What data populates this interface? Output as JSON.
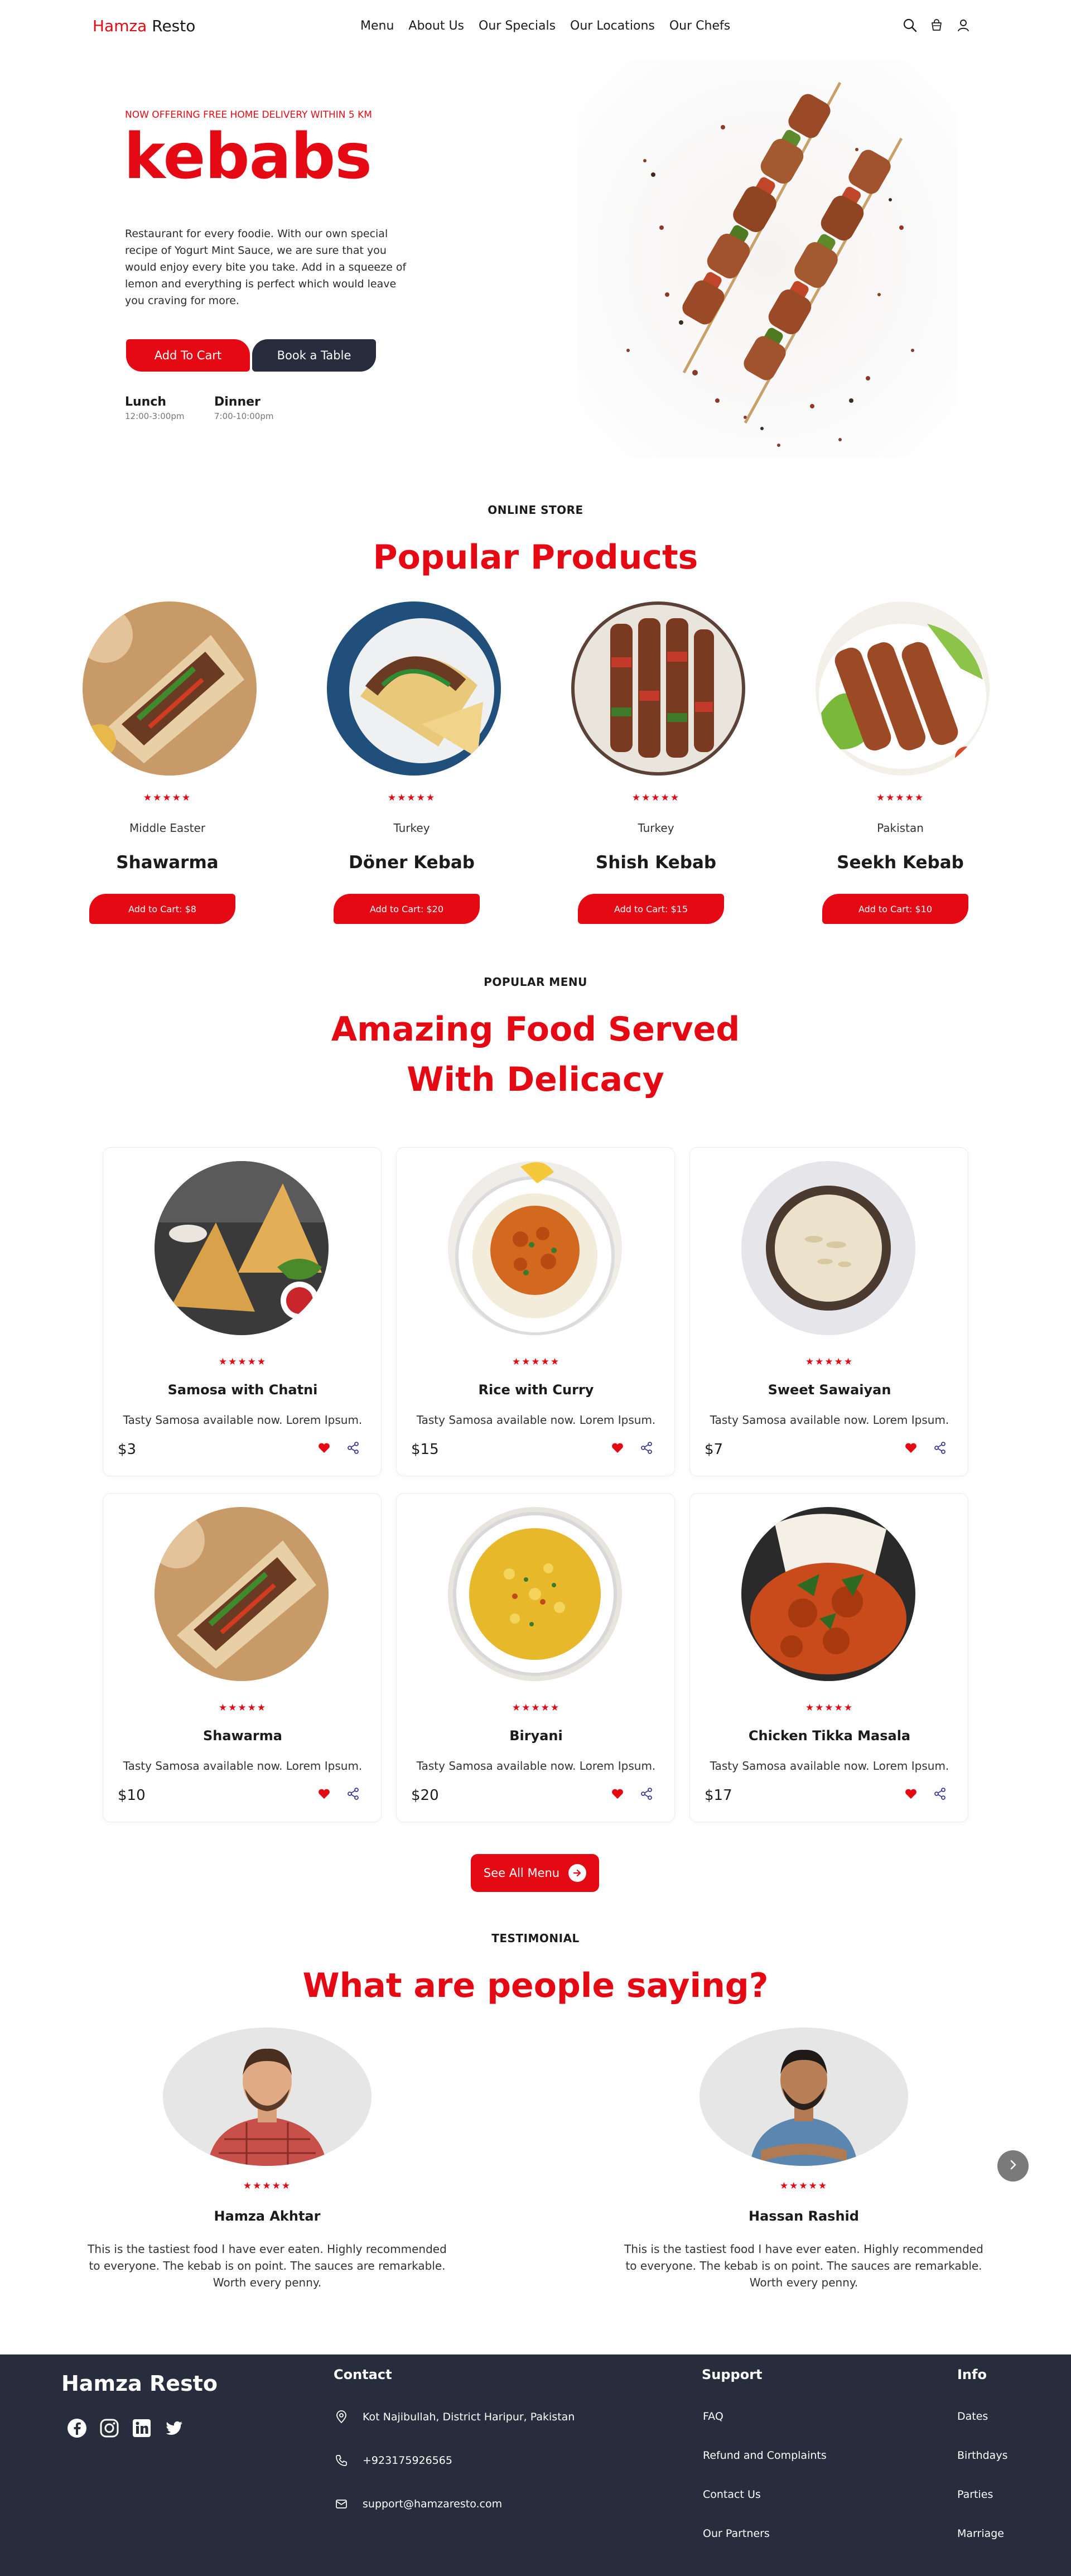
{
  "header": {
    "logo_part1": "Hamza",
    "logo_part2": " Resto",
    "nav": [
      "Menu",
      "About Us",
      "Our Specials",
      "Our Locations",
      "Our Chefs"
    ],
    "icons": [
      "search-icon",
      "cart-icon",
      "user-icon"
    ]
  },
  "hero": {
    "note": "NOW OFFERING FREE HOME DELIVERY WITHIN 5 KM",
    "title": "kebabs",
    "description": "Restaurant for every foodie. With our own special recipe of Yogurt Mint Sauce, we are sure that you would enjoy every bite you take. Add in a squeeze of lemon and everything is perfect which would leave you craving for more.",
    "add_to_cart": "Add To Cart",
    "book_table": "Book a Table",
    "lunch_label": "Lunch",
    "lunch_time": "12:00-3:00pm",
    "dinner_label": "Dinner",
    "dinner_time": "7:00-10:00pm"
  },
  "store": {
    "eyebrow": "ONLINE STORE",
    "heading": "Popular Products",
    "products": [
      {
        "origin": "Middle Easter",
        "name": "Shawarma",
        "cart": "Add to Cart: $8",
        "rating": 5
      },
      {
        "origin": "Turkey",
        "name": "Döner Kebab",
        "cart": "Add to Cart: $20",
        "rating": 5
      },
      {
        "origin": "Turkey",
        "name": "Shish Kebab",
        "cart": "Add to Cart: $15",
        "rating": 5
      },
      {
        "origin": "Pakistan",
        "name": "Seekh Kebab",
        "cart": "Add to Cart: $10",
        "rating": 5
      }
    ]
  },
  "menu": {
    "eyebrow": "POPULAR MENU",
    "heading_line1": "Amazing Food Served",
    "heading_line2": "With Delicacy",
    "items": [
      {
        "name": "Samosa with Chatni",
        "desc": "Tasty Samosa available now. Lorem Ipsum.",
        "price": "$3",
        "rating": 5
      },
      {
        "name": "Rice with Curry",
        "desc": "Tasty Samosa available now. Lorem Ipsum.",
        "price": "$15",
        "rating": 5
      },
      {
        "name": "Sweet Sawaiyan",
        "desc": "Tasty Samosa available now. Lorem Ipsum.",
        "price": "$7",
        "rating": 5
      },
      {
        "name": "Shawarma",
        "desc": "Tasty Samosa available now. Lorem Ipsum.",
        "price": "$10",
        "rating": 5
      },
      {
        "name": "Biryani",
        "desc": "Tasty Samosa available now. Lorem Ipsum.",
        "price": "$20",
        "rating": 5
      },
      {
        "name": "Chicken Tikka Masala",
        "desc": "Tasty Samosa available now. Lorem Ipsum.",
        "price": "$17",
        "rating": 5
      }
    ],
    "see_all": "See All Menu"
  },
  "testimonials": {
    "eyebrow": "TESTIMONIAL",
    "heading": "What are people saying?",
    "items": [
      {
        "name": "Hamza Akhtar",
        "quote": "This is the tastiest food I have ever eaten. Highly recommended to everyone. The kebab is on point. The sauces are remarkable. Worth every penny.",
        "rating": 5
      },
      {
        "name": "Hassan Rashid",
        "quote": "This is the tastiest food I have ever eaten. Highly recommended to everyone. The kebab is on point. The sauces are remarkable. Worth every penny.",
        "rating": 5
      }
    ]
  },
  "footer": {
    "brand": "Hamza Resto",
    "social": [
      "facebook-icon",
      "instagram-icon",
      "linkedin-icon",
      "twitter-icon"
    ],
    "contact_heading": "Contact",
    "address": "Kot Najibullah, District Haripur, Pakistan",
    "phone": "+923175926565",
    "email": "support@hamzaresto.com",
    "support_heading": "Support",
    "support_links": [
      "FAQ",
      "Refund and Complaints",
      "Contact Us",
      "Our Partners"
    ],
    "info_heading": "Info",
    "info_links": [
      "Dates",
      "Birthdays",
      "Parties",
      "Marriage"
    ]
  },
  "colors": {
    "accent": "#e50914",
    "dark": "#272d3c",
    "text": "#1b1b1b"
  }
}
